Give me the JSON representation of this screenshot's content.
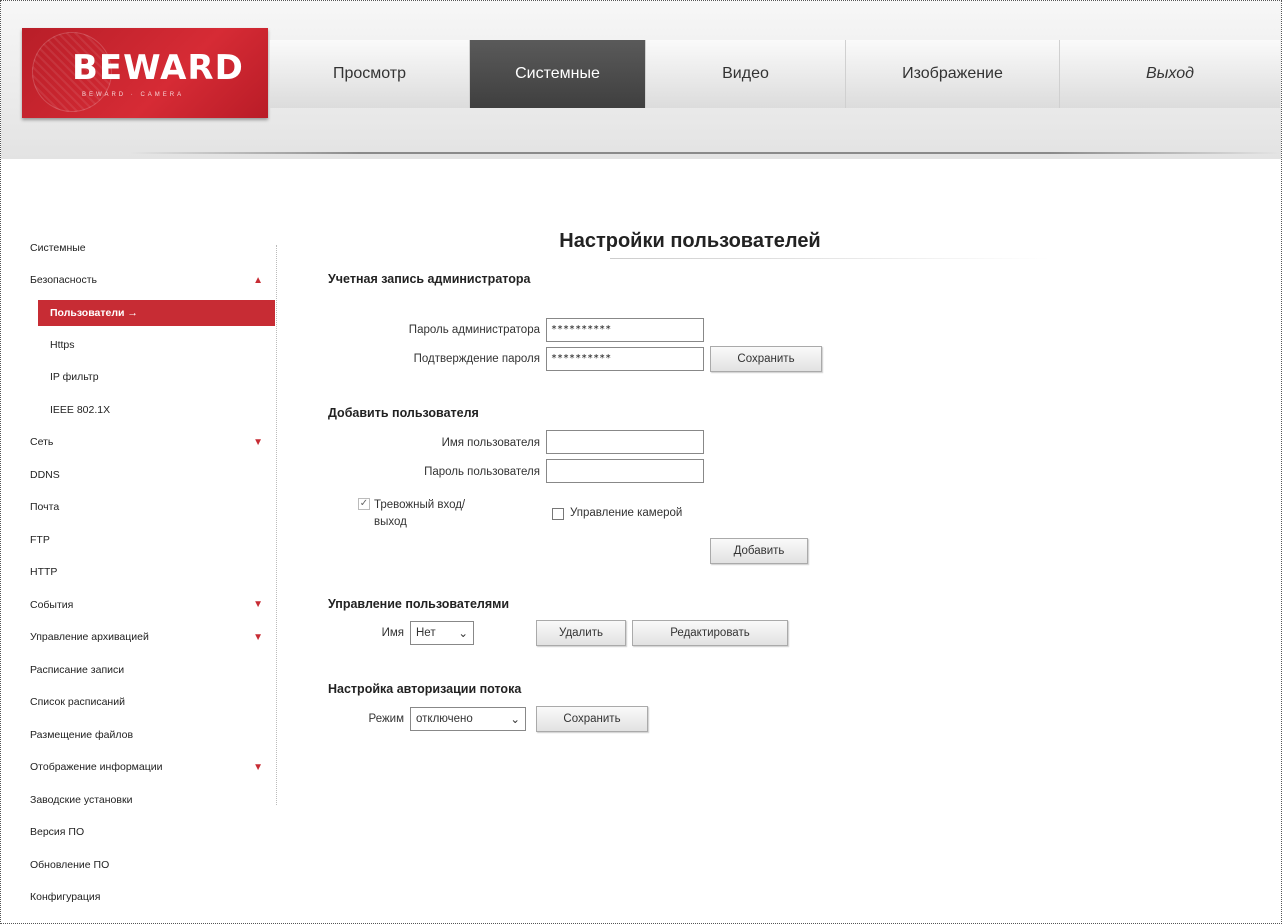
{
  "brand": {
    "logo_text": "BEWARD",
    "logo_sub": "BEWARD · CAMERA"
  },
  "nav": {
    "items": [
      "Просмотр",
      "Системные",
      "Видео",
      "Изображение",
      "Выход"
    ]
  },
  "sidebar": {
    "items": [
      {
        "label": "Системные"
      },
      {
        "label": "Безопасность",
        "caret": "▲"
      },
      {
        "label": "Пользователи →"
      },
      {
        "label": "Https"
      },
      {
        "label": "IP фильтр"
      },
      {
        "label": "IEEE 802.1X"
      },
      {
        "label": "Сеть",
        "caret": "▼"
      },
      {
        "label": "DDNS"
      },
      {
        "label": "Почта"
      },
      {
        "label": "FTP"
      },
      {
        "label": "HTTP"
      },
      {
        "label": "События",
        "caret": "▼"
      },
      {
        "label": "Управление архивацией",
        "caret": "▼"
      },
      {
        "label": "Расписание записи"
      },
      {
        "label": "Список расписаний"
      },
      {
        "label": "Размещение файлов"
      },
      {
        "label": "Отображение информации",
        "caret": "▼"
      },
      {
        "label": "Заводские установки"
      },
      {
        "label": "Версия ПО"
      },
      {
        "label": "Обновление ПО"
      },
      {
        "label": "Конфигурация"
      }
    ]
  },
  "main": {
    "title": "Настройки пользователей",
    "admin": {
      "section": "Учетная запись администратора",
      "password_label": "Пароль администратора",
      "password_value": "**********",
      "confirm_label": "Подтверждение пароля",
      "confirm_value": "**********",
      "save_label": "Сохранить"
    },
    "add_user": {
      "section": "Добавить пользователя",
      "username_label": "Имя пользователя",
      "username_value": "",
      "password_label": "Пароль пользователя",
      "password_value": "",
      "alarm_label": "Тревожный вход/выход",
      "alarm_checked": "✓",
      "ptz_label": "Управление камерой",
      "add_label": "Добавить"
    },
    "manage": {
      "section": "Управление пользователями",
      "name_label": "Имя",
      "name_select": "Нет",
      "delete_label": "Удалить",
      "edit_label": "Редактировать"
    },
    "stream_auth": {
      "section": "Настройка авторизации потока",
      "mode_label": "Режим",
      "mode_select": "отключено",
      "save_label": "Сохранить"
    }
  }
}
